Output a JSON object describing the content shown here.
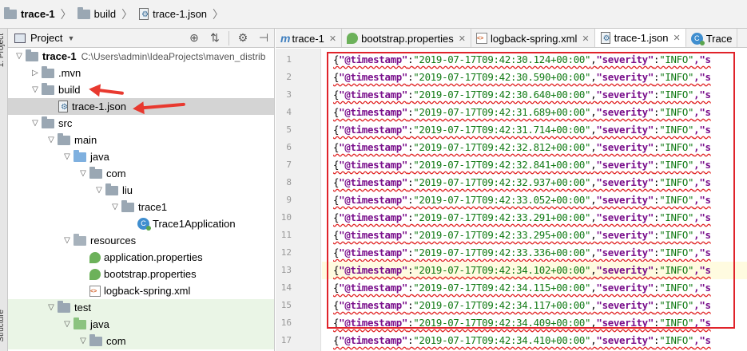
{
  "breadcrumb": [
    "trace-1",
    "build",
    "trace-1.json"
  ],
  "project_panel": {
    "title": "Project",
    "side_labels": [
      "1: Project",
      "Structure"
    ],
    "tree": [
      {
        "label": "trace-1",
        "path": "C:\\Users\\admin\\IdeaProjects\\maven_distrib",
        "depth": 0,
        "expanded": true,
        "icon": "project-folder-icon",
        "bold": true
      },
      {
        "label": ".mvn",
        "depth": 1,
        "expanded": false,
        "icon": "folder-icon"
      },
      {
        "label": "build",
        "depth": 1,
        "expanded": true,
        "icon": "folder-icon"
      },
      {
        "label": "trace-1.json",
        "depth": 2,
        "icon": "json-file-icon",
        "selected": true
      },
      {
        "label": "src",
        "depth": 1,
        "expanded": true,
        "icon": "folder-icon"
      },
      {
        "label": "main",
        "depth": 2,
        "expanded": true,
        "icon": "folder-icon"
      },
      {
        "label": "java",
        "depth": 3,
        "expanded": true,
        "icon": "source-folder-icon"
      },
      {
        "label": "com",
        "depth": 4,
        "expanded": true,
        "icon": "package-icon"
      },
      {
        "label": "liu",
        "depth": 5,
        "expanded": true,
        "icon": "package-icon"
      },
      {
        "label": "trace1",
        "depth": 6,
        "expanded": true,
        "icon": "package-icon"
      },
      {
        "label": "Trace1Application",
        "depth": 7,
        "icon": "spring-class-icon"
      },
      {
        "label": "resources",
        "depth": 3,
        "expanded": true,
        "icon": "resources-folder-icon"
      },
      {
        "label": "application.properties",
        "depth": 4,
        "icon": "spring-properties-icon"
      },
      {
        "label": "bootstrap.properties",
        "depth": 4,
        "icon": "spring-properties-icon"
      },
      {
        "label": "logback-spring.xml",
        "depth": 4,
        "icon": "xml-file-icon"
      },
      {
        "label": "test",
        "depth": 2,
        "expanded": true,
        "icon": "folder-icon",
        "test": true
      },
      {
        "label": "java",
        "depth": 3,
        "expanded": true,
        "icon": "test-source-folder-icon",
        "test": true
      },
      {
        "label": "com",
        "depth": 4,
        "expanded": true,
        "icon": "package-icon",
        "test": true
      }
    ]
  },
  "tabs": [
    {
      "label": "trace-1",
      "icon": "maven-icon",
      "active": false
    },
    {
      "label": "bootstrap.properties",
      "icon": "spring-properties-icon",
      "active": false
    },
    {
      "label": "logback-spring.xml",
      "icon": "xml-file-icon",
      "active": false
    },
    {
      "label": "trace-1.json",
      "icon": "json-file-icon",
      "active": true
    },
    {
      "label": "Trace",
      "icon": "spring-class-icon",
      "active": false
    }
  ],
  "editor": {
    "lines": [
      {
        "n": "1",
        "ts": "2019-07-17T09:42:30.124+00:00"
      },
      {
        "n": "2",
        "ts": "2019-07-17T09:42:30.590+00:00"
      },
      {
        "n": "3",
        "ts": "2019-07-17T09:42:30.640+00:00"
      },
      {
        "n": "4",
        "ts": "2019-07-17T09:42:31.689+00:00"
      },
      {
        "n": "5",
        "ts": "2019-07-17T09:42:31.714+00:00"
      },
      {
        "n": "6",
        "ts": "2019-07-17T09:42:32.812+00:00"
      },
      {
        "n": "7",
        "ts": "2019-07-17T09:42:32.841+00:00"
      },
      {
        "n": "8",
        "ts": "2019-07-17T09:42:32.937+00:00"
      },
      {
        "n": "9",
        "ts": "2019-07-17T09:42:33.052+00:00"
      },
      {
        "n": "10",
        "ts": "2019-07-17T09:42:33.291+00:00"
      },
      {
        "n": "11",
        "ts": "2019-07-17T09:42:33.295+00:00"
      },
      {
        "n": "12",
        "ts": "2019-07-17T09:42:33.336+00:00"
      },
      {
        "n": "13",
        "ts": "2019-07-17T09:42:34.102+00:00",
        "current": true
      },
      {
        "n": "14",
        "ts": "2019-07-17T09:42:34.115+00:00"
      },
      {
        "n": "15",
        "ts": "2019-07-17T09:42:34.117+00:00"
      },
      {
        "n": "16",
        "ts": "2019-07-17T09:42:34.409+00:00"
      },
      {
        "n": "17",
        "ts": "2019-07-17T09:42:34.410+00:00"
      }
    ],
    "key_timestamp": "\"@timestamp\"",
    "key_severity": "\"severity\"",
    "severity_value": "\"INFO\"",
    "tail": ",\"s"
  },
  "colors": {
    "annotation": "#e0232a",
    "json_key": "#7a0f8c",
    "json_string": "#117a14"
  }
}
